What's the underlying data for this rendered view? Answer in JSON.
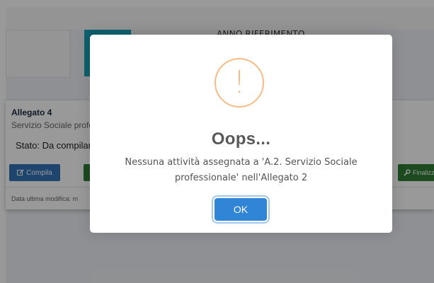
{
  "header": {
    "anno_label": "ANNO RIFERIMENTO"
  },
  "card": {
    "title": "Allegato 4",
    "subtitle": "Servizio Sociale profe",
    "status": "Stato: Da compilare",
    "compila_label": "Compila",
    "finalizza_label": "Finalizza",
    "footer": "Data ultima modifica: m"
  },
  "dialog": {
    "icon": "!",
    "title": "Oops...",
    "message": "Nessuna attività assegnata a 'A.2. Servizio Sociale professionale' nell'Allegato 2",
    "ok_label": "OK"
  },
  "colors": {
    "teal_tile": "#17a2b8",
    "primary": "#3174b8",
    "success": "#2e7d32",
    "warning_icon": "#f8bb86",
    "ok_button": "#3085d6"
  },
  "icons": {
    "edit": "edit-icon",
    "wrench": "wrench-icon",
    "warning": "exclamation-icon"
  }
}
